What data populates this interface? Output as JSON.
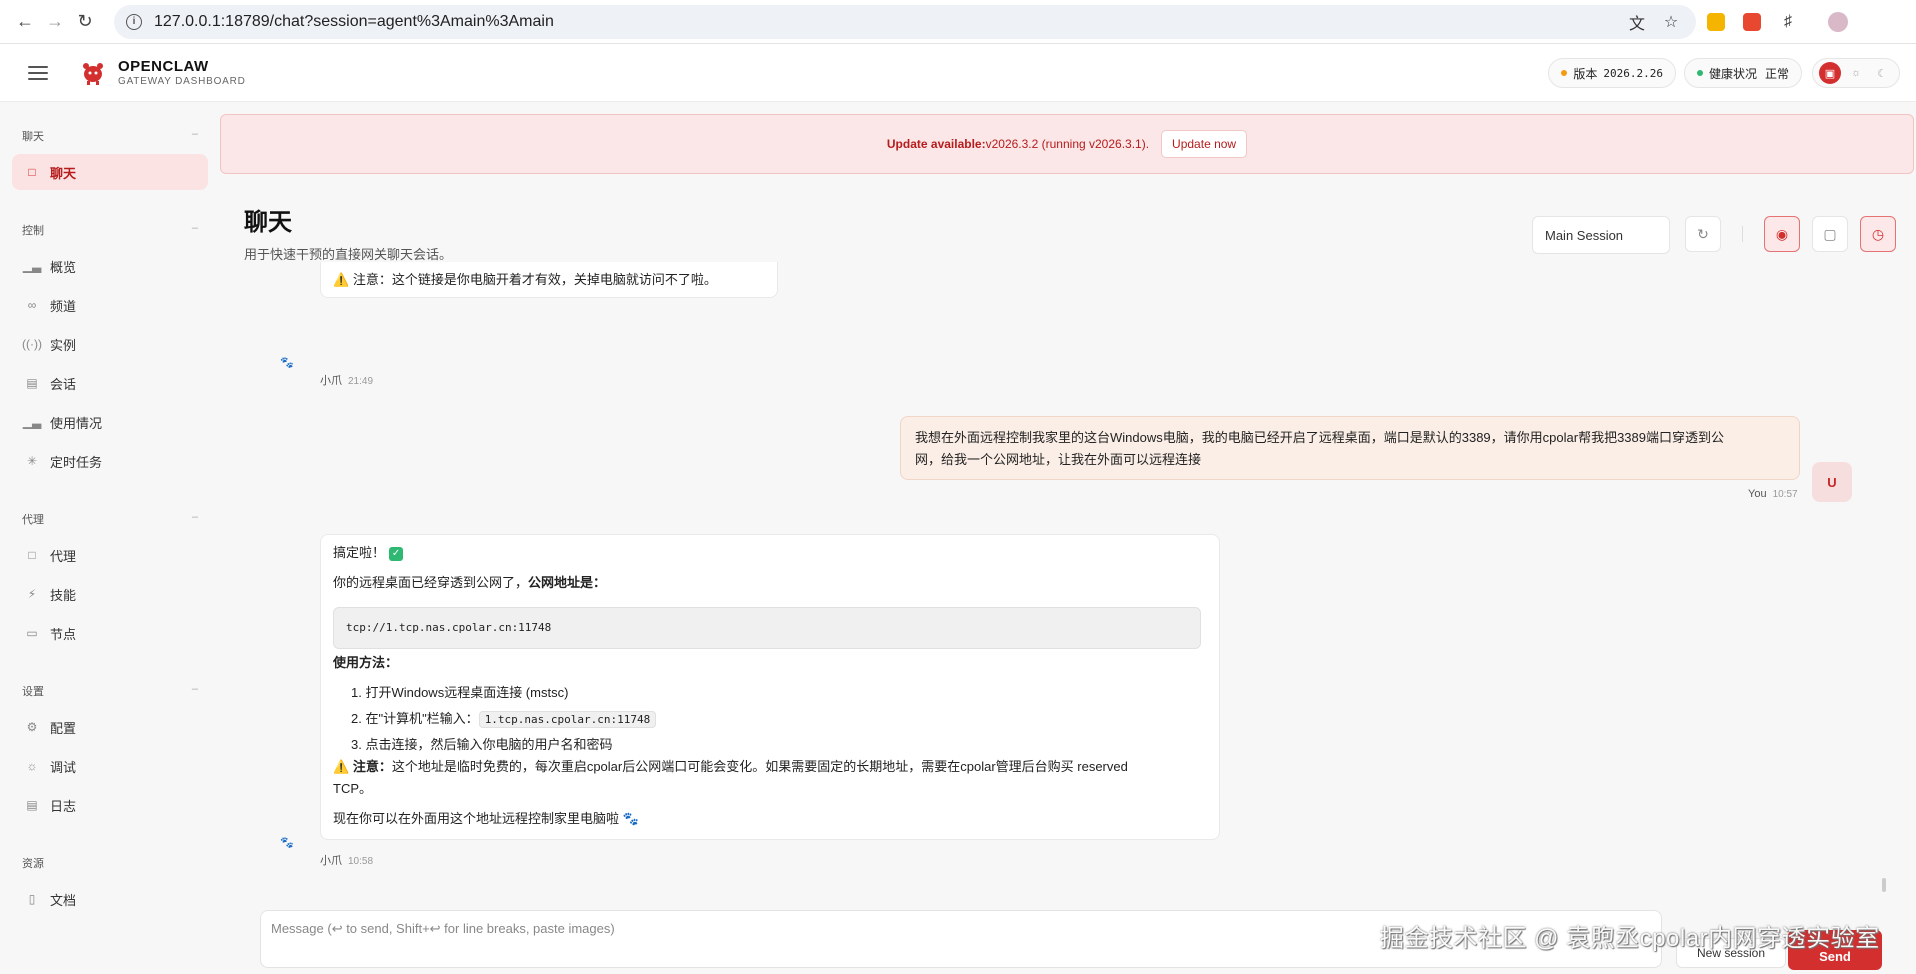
{
  "browser": {
    "url": "127.0.0.1:18789/chat?session=agent%3Amain%3Amain"
  },
  "header": {
    "brand_name": "OPENCLAW",
    "brand_sub": "GATEWAY DASHBOARD",
    "version_label": "版本",
    "version_value": "2026.2.26",
    "health_label": "健康状况",
    "health_value": "正常",
    "colors": {
      "accent": "#d32f2f",
      "version_dot": "#f39c12",
      "health_dot": "#2eb872"
    }
  },
  "sidebar": {
    "groups": [
      {
        "title": "聊天",
        "items": [
          {
            "label": "聊天",
            "icon": "chat-icon",
            "active": true
          }
        ]
      },
      {
        "title": "控制",
        "items": [
          {
            "label": "概览",
            "icon": "bar-chart-icon"
          },
          {
            "label": "频道",
            "icon": "link-icon"
          },
          {
            "label": "实例",
            "icon": "signal-icon"
          },
          {
            "label": "会话",
            "icon": "document-icon"
          },
          {
            "label": "使用情况",
            "icon": "bar-chart-icon"
          },
          {
            "label": "定时任务",
            "icon": "spinner-icon"
          }
        ]
      },
      {
        "title": "代理",
        "items": [
          {
            "label": "代理",
            "icon": "folder-icon"
          },
          {
            "label": "技能",
            "icon": "bolt-icon"
          },
          {
            "label": "节点",
            "icon": "monitor-icon"
          }
        ]
      },
      {
        "title": "设置",
        "items": [
          {
            "label": "配置",
            "icon": "gear-icon"
          },
          {
            "label": "调试",
            "icon": "bug-icon"
          },
          {
            "label": "日志",
            "icon": "log-icon"
          }
        ]
      },
      {
        "title": "资源",
        "items": [
          {
            "label": "文档",
            "icon": "book-icon"
          }
        ]
      }
    ]
  },
  "banner": {
    "strong": "Update available:",
    "text": " v2026.3.2 (running v2026.3.1).",
    "button": "Update now"
  },
  "page": {
    "title": "聊天",
    "subtitle": "用于快速干预的直接网关聊天会话。",
    "session_select": "Main Session"
  },
  "chat": {
    "msg1": {
      "text": "注意：这个链接是你电脑开着才有效，关掉电脑就访问不了啦。",
      "sender": "小爪",
      "time": "21:49"
    },
    "msg2": {
      "line1": "我想在外面远程控制我家里的这台Windows电脑，我的电脑已经开启了远程桌面，端口是默认的3389，请你用cpolar帮我把3389端口穿透到公",
      "line2": "网，给我一个公网地址，让我在外面可以远程连接",
      "sender": "You",
      "time": "10:57",
      "avatar": "U"
    },
    "msg3": {
      "done": "搞定啦！",
      "intro": "你的远程桌面已经穿透到公网了，",
      "intro_bold": "公网地址是：",
      "code": "tcp://1.tcp.nas.cpolar.cn:11748",
      "usage_title": "使用方法：",
      "step1": "1. 打开Windows远程桌面连接 (mstsc)",
      "step2_pre": "2. 在\"计算机\"栏输入：",
      "step2_code": "1.tcp.nas.cpolar.cn:11748",
      "step3": "3. 点击连接，然后输入你电脑的用户名和密码",
      "note_bold": "注意：",
      "note_line1": "这个地址是临时免费的，每次重启cpolar后公网端口可能会变化。如果需要固定的长期地址，需要在cpolar管理后台购买 reserved",
      "note_line2": "TCP。",
      "closing": "现在你可以在外面用这个地址远程控制家里电脑啦 🐾",
      "sender": "小爪",
      "time": "10:58"
    }
  },
  "composer": {
    "placeholder": "Message (↩ to send, Shift+↩ for line breaks, paste images)",
    "new_session": "New session",
    "send": "Send"
  },
  "watermark": "掘金技术社区 @ 袁煦丞cpolar内网穿透实验室"
}
